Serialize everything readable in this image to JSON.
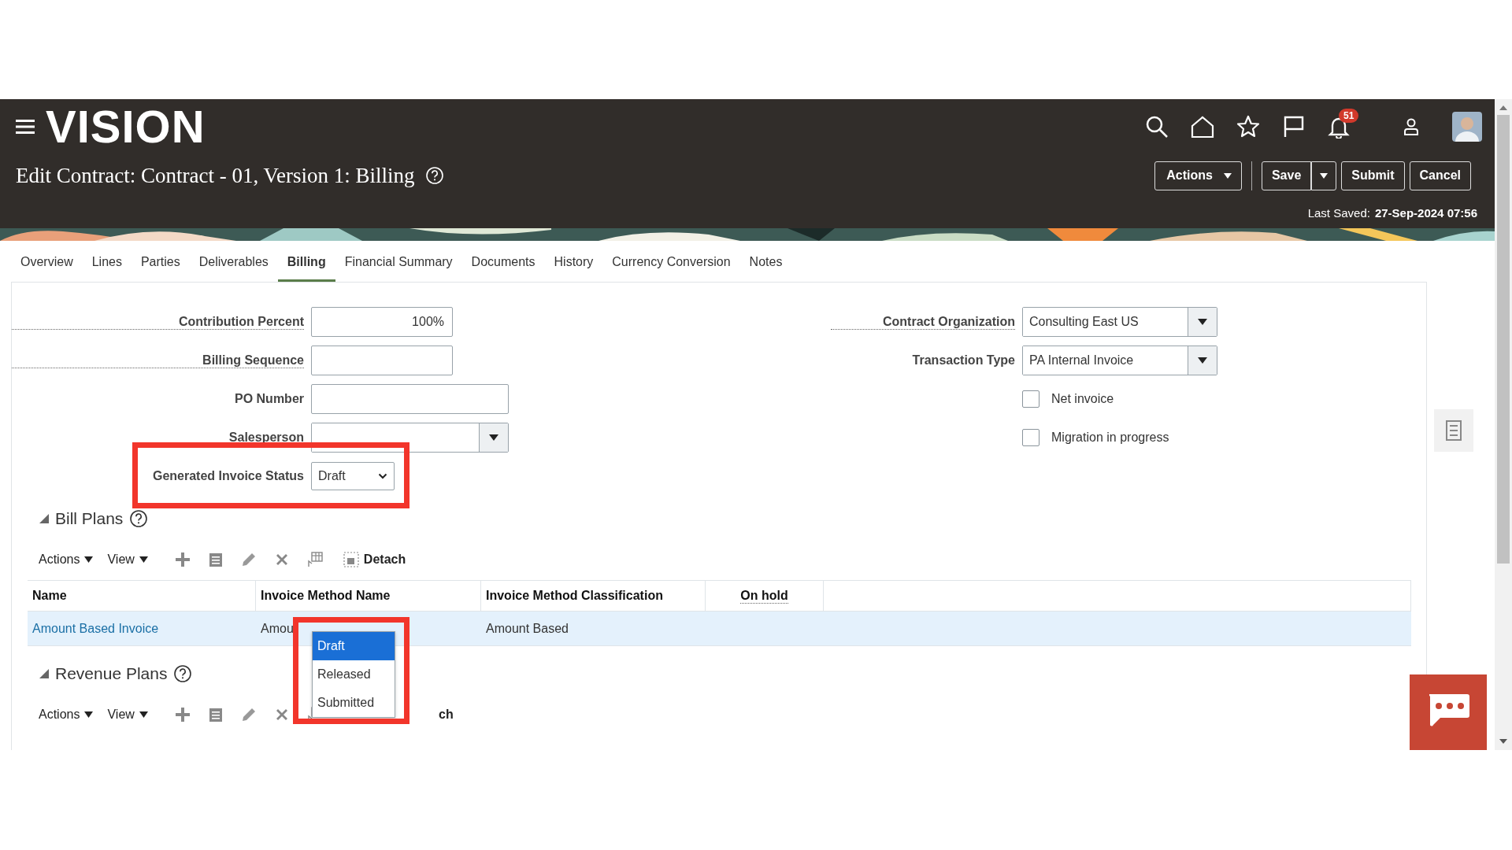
{
  "header": {
    "logo": "VISION",
    "notification_count": "51",
    "title": "Edit Contract: Contract - 01, Version 1: Billing",
    "buttons": [
      {
        "label": "Actions",
        "kind": "menu"
      },
      {
        "label": "Save",
        "kind": "split"
      },
      {
        "label": "Submit",
        "kind": "plain"
      },
      {
        "label": "Cancel",
        "kind": "plain"
      }
    ],
    "last_saved_label": "Last Saved:",
    "last_saved_value": "27-Sep-2024 07:56"
  },
  "tabs": [
    {
      "label": "Overview",
      "selected": false
    },
    {
      "label": "Lines",
      "selected": false
    },
    {
      "label": "Parties",
      "selected": false
    },
    {
      "label": "Deliverables",
      "selected": false
    },
    {
      "label": "Billing",
      "selected": true
    },
    {
      "label": "Financial Summary",
      "selected": false
    },
    {
      "label": "Documents",
      "selected": false
    },
    {
      "label": "History",
      "selected": false
    },
    {
      "label": "Currency Conversion",
      "selected": false
    },
    {
      "label": "Notes",
      "selected": false
    }
  ],
  "form": {
    "left": [
      {
        "label": "Contribution Percent",
        "kind": "short-text",
        "value": "100%",
        "help": true
      },
      {
        "label": "Billing Sequence",
        "kind": "short-text",
        "help": true
      },
      {
        "label": "PO Number",
        "kind": "text",
        "help": false
      },
      {
        "label": "Salesperson",
        "kind": "lov",
        "help": false
      },
      {
        "label": "Generated Invoice Status",
        "kind": "select",
        "value": "Draft",
        "help": false
      }
    ],
    "right": [
      {
        "label": "Contract Organization",
        "kind": "lov",
        "value": "Consulting East US",
        "help": true
      },
      {
        "label": "Transaction Type",
        "kind": "lov",
        "value": "PA Internal Invoice",
        "help": false
      },
      {
        "label": "Net invoice",
        "kind": "checkbox",
        "checked": false
      },
      {
        "label": "Migration in progress",
        "kind": "checkbox",
        "checked": false
      }
    ]
  },
  "sections": [
    {
      "title": "Bill Plans",
      "toolbar": {
        "menus": [
          "Actions",
          "View"
        ],
        "detach": "Detach"
      },
      "columns": [
        {
          "label": "Name",
          "help": false
        },
        {
          "label": "Invoice Method Name",
          "help": false
        },
        {
          "label": "Invoice Method Classification",
          "help": false
        },
        {
          "label": "On hold",
          "help": true
        }
      ],
      "rows": [
        {
          "cells": [
            "Amount Based Invoice",
            "Amou",
            "Amount Based"
          ],
          "selected": true
        }
      ]
    },
    {
      "title": "Revenue Plans",
      "toolbar": {
        "menus": [
          "Actions",
          "View"
        ],
        "detach_tail": "ch"
      }
    }
  ],
  "status_options": [
    {
      "label": "Draft",
      "selected": true
    },
    {
      "label": "Released",
      "selected": false
    },
    {
      "label": "Submitted",
      "selected": false
    }
  ]
}
